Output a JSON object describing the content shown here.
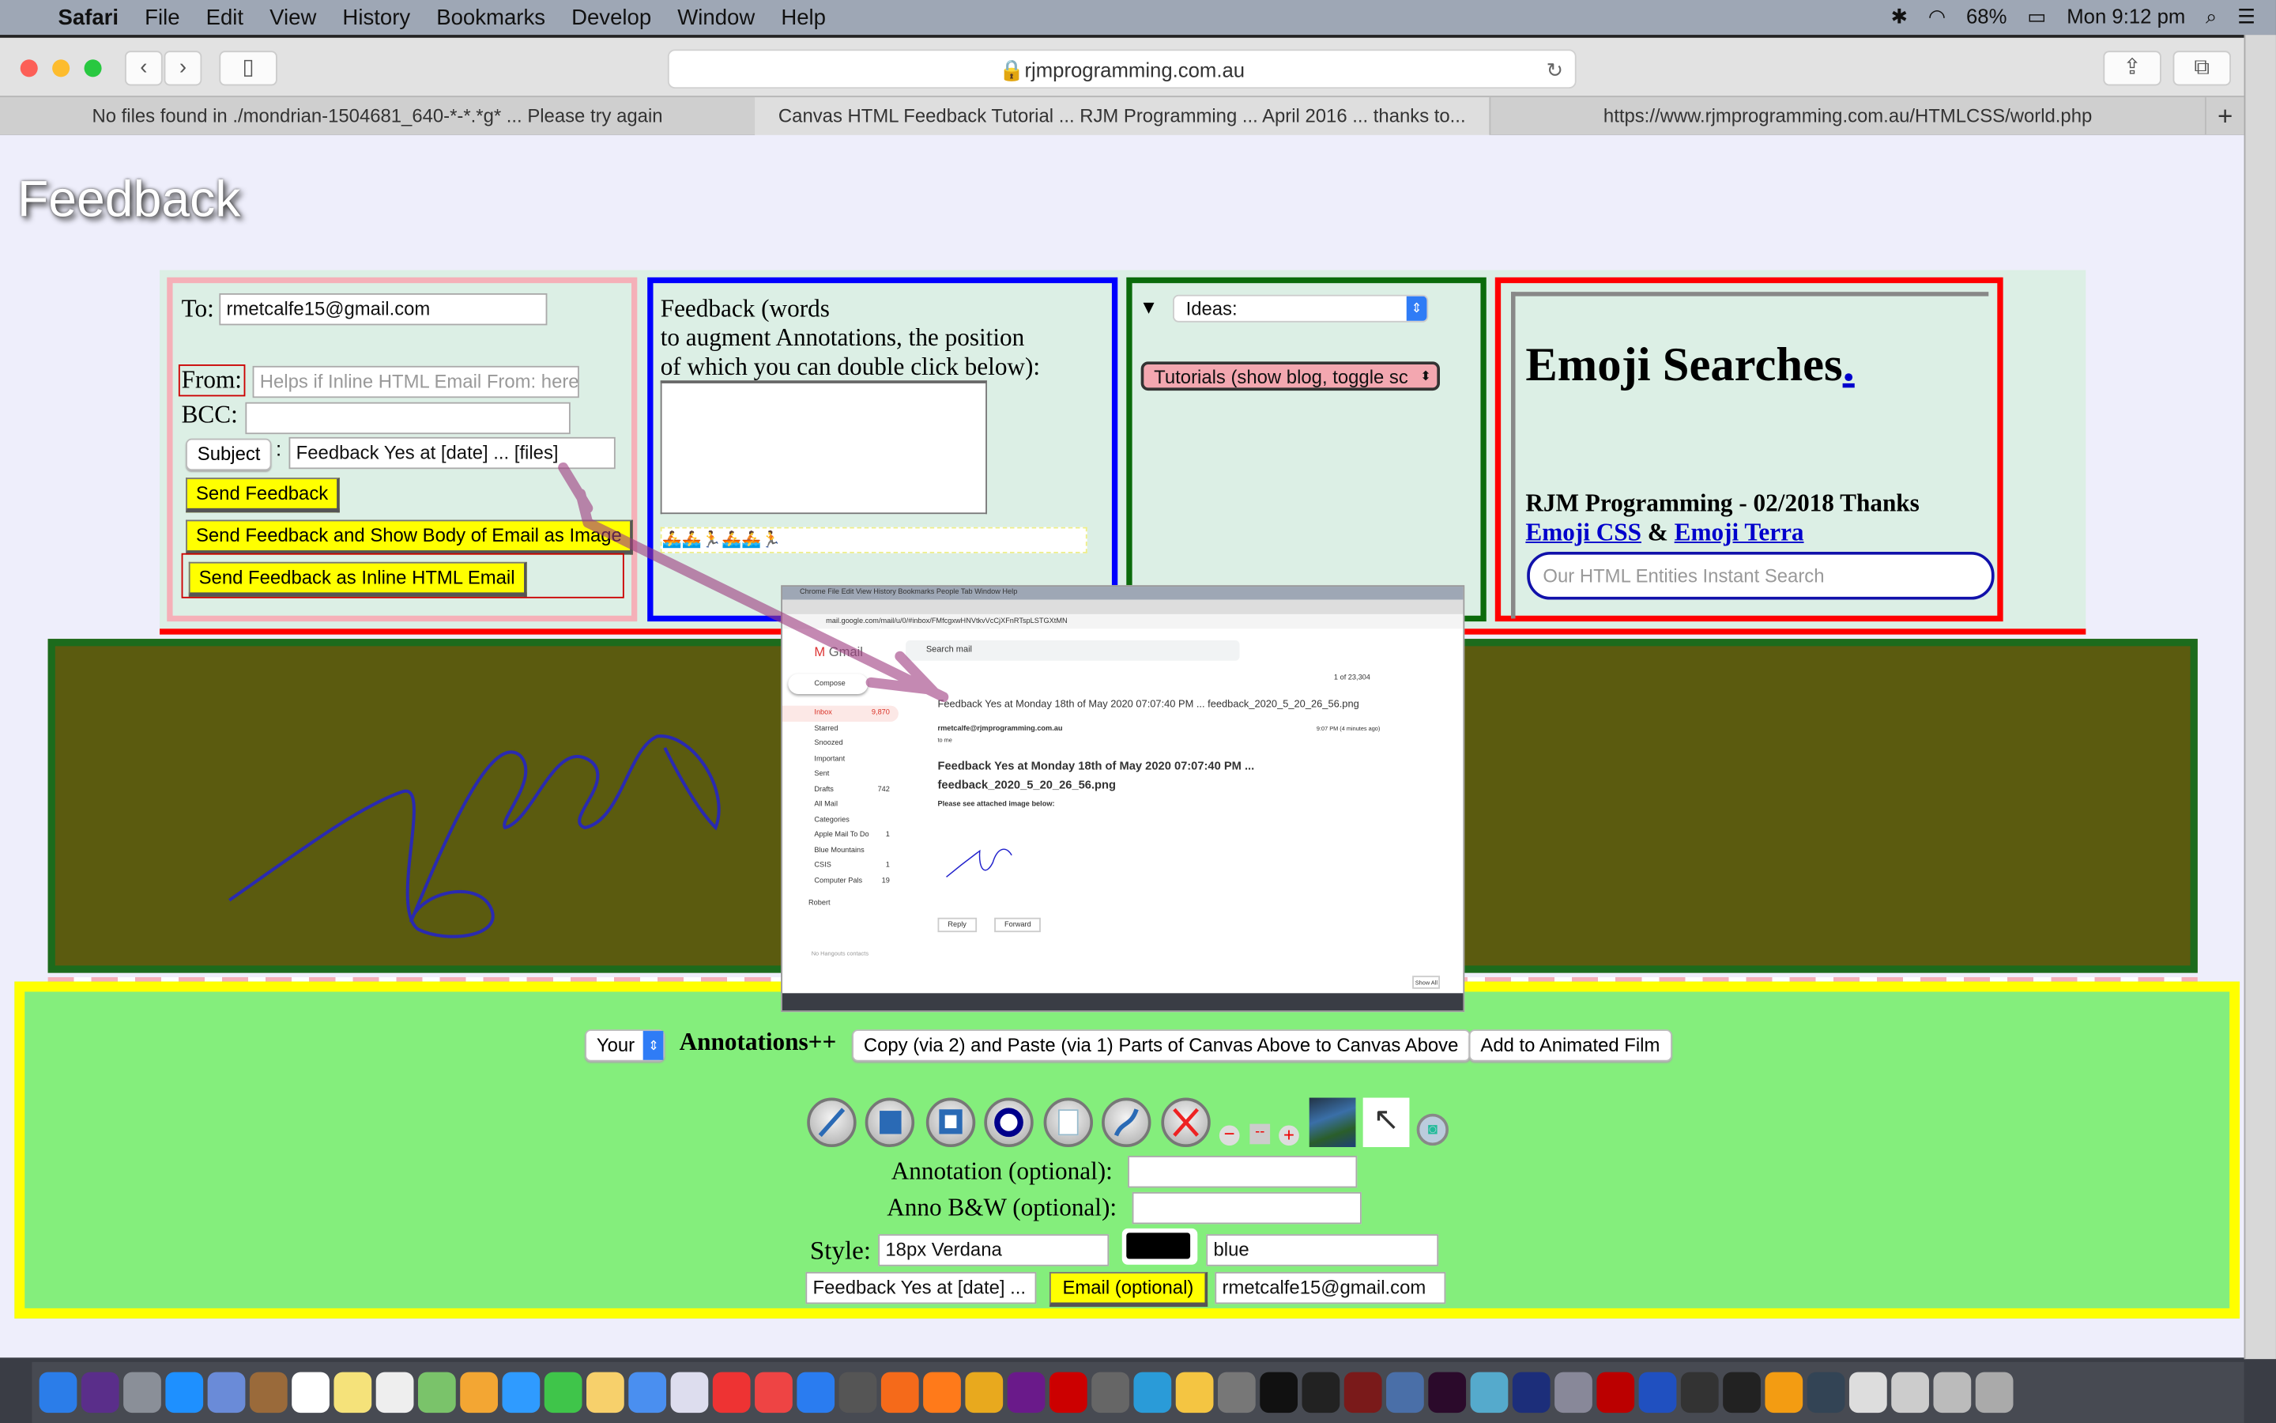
{
  "menubar": {
    "app": "Safari",
    "items": [
      "File",
      "Edit",
      "View",
      "History",
      "Bookmarks",
      "Develop",
      "Window",
      "Help"
    ],
    "battery": "68%",
    "clock": "Mon 9:12 pm"
  },
  "browser": {
    "url": "rjmprogramming.com.au",
    "tabs": [
      "No files found in ./mondrian-1504681_640-*-*.*g* ... Please try again",
      "Canvas HTML Feedback Tutorial ... RJM Programming ... April 2016 ... thanks to...",
      "https://www.rjmprogramming.com.au/HTMLCSS/world.php"
    ]
  },
  "page": {
    "title": "Feedback"
  },
  "email_form": {
    "to_label": "To:",
    "to_value": "rmetcalfe15@gmail.com",
    "from_label": "From:",
    "from_placeholder": "Helps if Inline HTML Email From: here",
    "bcc_label": "BCC:",
    "subject_button": "Subject",
    "subject_colon": ":",
    "subject_value": "Feedback Yes  at [date] ... [files]",
    "send": "Send Feedback",
    "send_image": "Send Feedback and Show Body of Email as Image",
    "send_inline": "Send Feedback as Inline HTML Email"
  },
  "feedback_box": {
    "text_line1": "Feedback (words",
    "text_line2": "to augment Annotations, the position",
    "text_line3": "of which you can double click below):",
    "emoji_strip": "🚣🚣🏃🚣🚣🏃"
  },
  "ideas_box": {
    "toggle": "▼",
    "ideas_select": "Ideas:",
    "tutorials_select": "Tutorials (show blog, toggle sc"
  },
  "emoji_box": {
    "heading": "Emoji Searches",
    "heading_link": ".",
    "credit": "RJM Programming - 02/2018 Thanks",
    "link1": "Emoji CSS",
    "amp": "&",
    "link2": "Emoji Terra",
    "search_placeholder": "Our HTML Entities Instant Search"
  },
  "annotations": {
    "your_select": "Your",
    "heading": "Annotations++",
    "copy_paste": "Copy (via 2) and Paste (via 1) Parts of Canvas Above to Canvas Above",
    "add_film": "Add to Animated Film",
    "tools": [
      "line-tool",
      "filled-rectangle-tool",
      "rectangle-tool",
      "ellipse-tool",
      "empty-rectangle-tool",
      "curve-tool",
      "clear-tool"
    ],
    "annotation_label": "Annotation (optional):",
    "anno_bw_label": "Anno B&W (optional):",
    "style_label": "Style:",
    "style_value": "18px Verdana",
    "color_value": "blue",
    "swatch": "#000000",
    "subject_value": "Feedback Yes  at [date] ...",
    "email_button": "Email (optional)",
    "email_value": "rmetcalfe15@gmail.com"
  },
  "inset": {
    "menubar": "Chrome  File  Edit  View  History  Bookmarks  People  Tab  Window  Help",
    "url": "mail.google.com/mail/u/0/#inbox/FMfcgxwHNVtkvVcCjXFnRTspLSTGXtMN",
    "brand": "Gmail",
    "search": "Search mail",
    "compose": "Compose",
    "nav": [
      {
        "label": "Inbox",
        "count": "9,870"
      },
      {
        "label": "Starred",
        "count": ""
      },
      {
        "label": "Snoozed",
        "count": ""
      },
      {
        "label": "Important",
        "count": ""
      },
      {
        "label": "Sent",
        "count": ""
      },
      {
        "label": "Drafts",
        "count": "742"
      },
      {
        "label": "All Mail",
        "count": ""
      },
      {
        "label": "Categories",
        "count": ""
      },
      {
        "label": "Apple Mail To Do",
        "count": "1"
      },
      {
        "label": "Blue Mountains",
        "count": ""
      },
      {
        "label": "CSIS",
        "count": "1"
      },
      {
        "label": "Computer Pals",
        "count": "19"
      }
    ],
    "pager": "1 of 23,304",
    "subject": "Feedback Yes at Monday 18th of May 2020 07:07:40 PM ... feedback_2020_5_20_26_56.png",
    "sender": "rmetcalfe@rjmprogramming.com.au",
    "to_me": "to me",
    "time": "9:07 PM (4 minutes ago)",
    "body_title1": "Feedback Yes at Monday 18th of May 2020 07:07:40 PM ...",
    "body_title2": "feedback_2020_5_20_26_56.png",
    "body_text": "Please see attached image below:",
    "reply": "Reply",
    "forward": "Forward",
    "user": "Robert",
    "no_hangouts": "No Hangouts contacts",
    "show_all": "Show All"
  },
  "colors": {
    "accent_yellow": "#ffff00",
    "panel_green": "#84ee7c",
    "canvas_olive": "#5b5b0f",
    "pen": "#2a2ab0"
  }
}
